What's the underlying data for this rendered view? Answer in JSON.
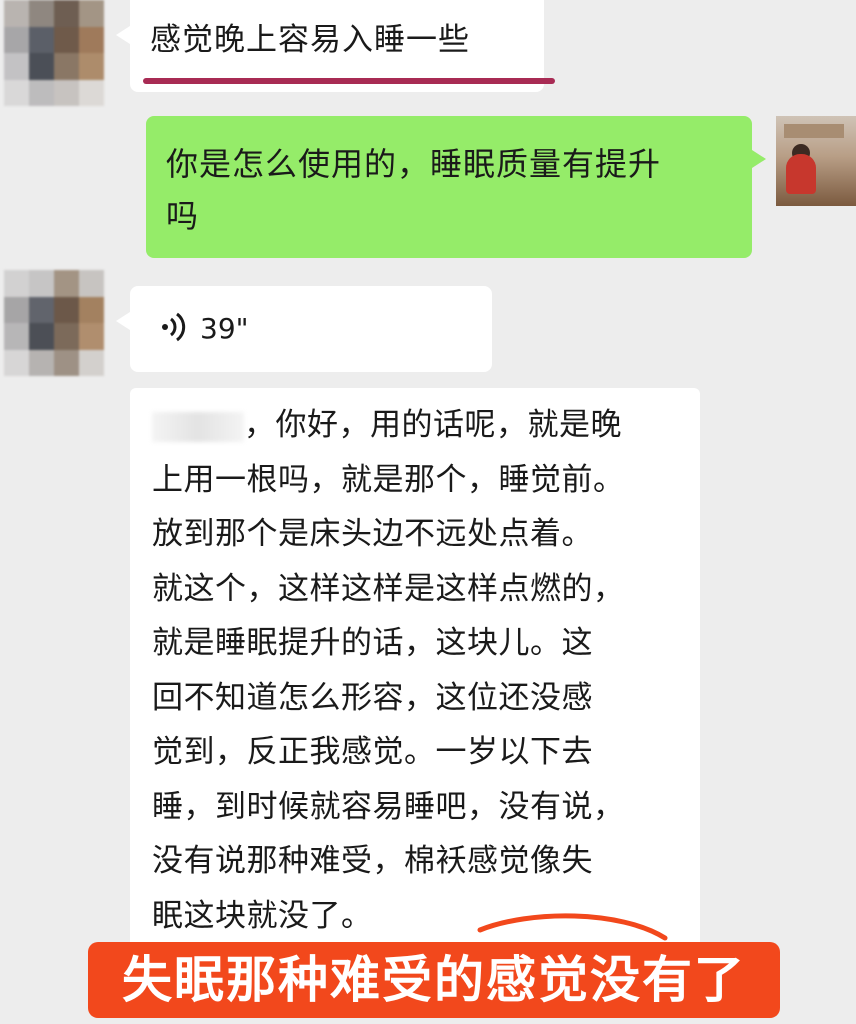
{
  "colors": {
    "background": "#ededed",
    "incoming_bubble": "#ffffff",
    "outgoing_bubble": "#95ec69",
    "underline": "#a82b54",
    "caption_bg": "#f2481c",
    "caption_text": "#ffffff"
  },
  "messages": {
    "incoming_1": {
      "text": "感觉晚上容易入睡一些"
    },
    "outgoing_1": {
      "line1": "你是怎么使用的，睡眠质量有提升",
      "line2": "吗"
    },
    "voice": {
      "icon": "voice-wave-icon",
      "duration": "39\""
    },
    "transcript": {
      "lines": [
        "，你好，用的话呢，就是晚",
        "上用一根吗，就是那个，睡觉前。",
        "放到那个是床头边不远处点着。",
        "就这个，这样这样是这样点燃的，",
        "就是睡眠提升的话，这块儿。这",
        "回不知道怎么形容，这位还没感",
        "觉到，反正我感觉。一岁以下去",
        "睡，到时候就容易睡吧，没有说，",
        "没有说那种难受，棉袄感觉像失",
        "眠这块就没了。"
      ]
    }
  },
  "caption": {
    "text": "失眠那种难受的感觉没有了"
  }
}
